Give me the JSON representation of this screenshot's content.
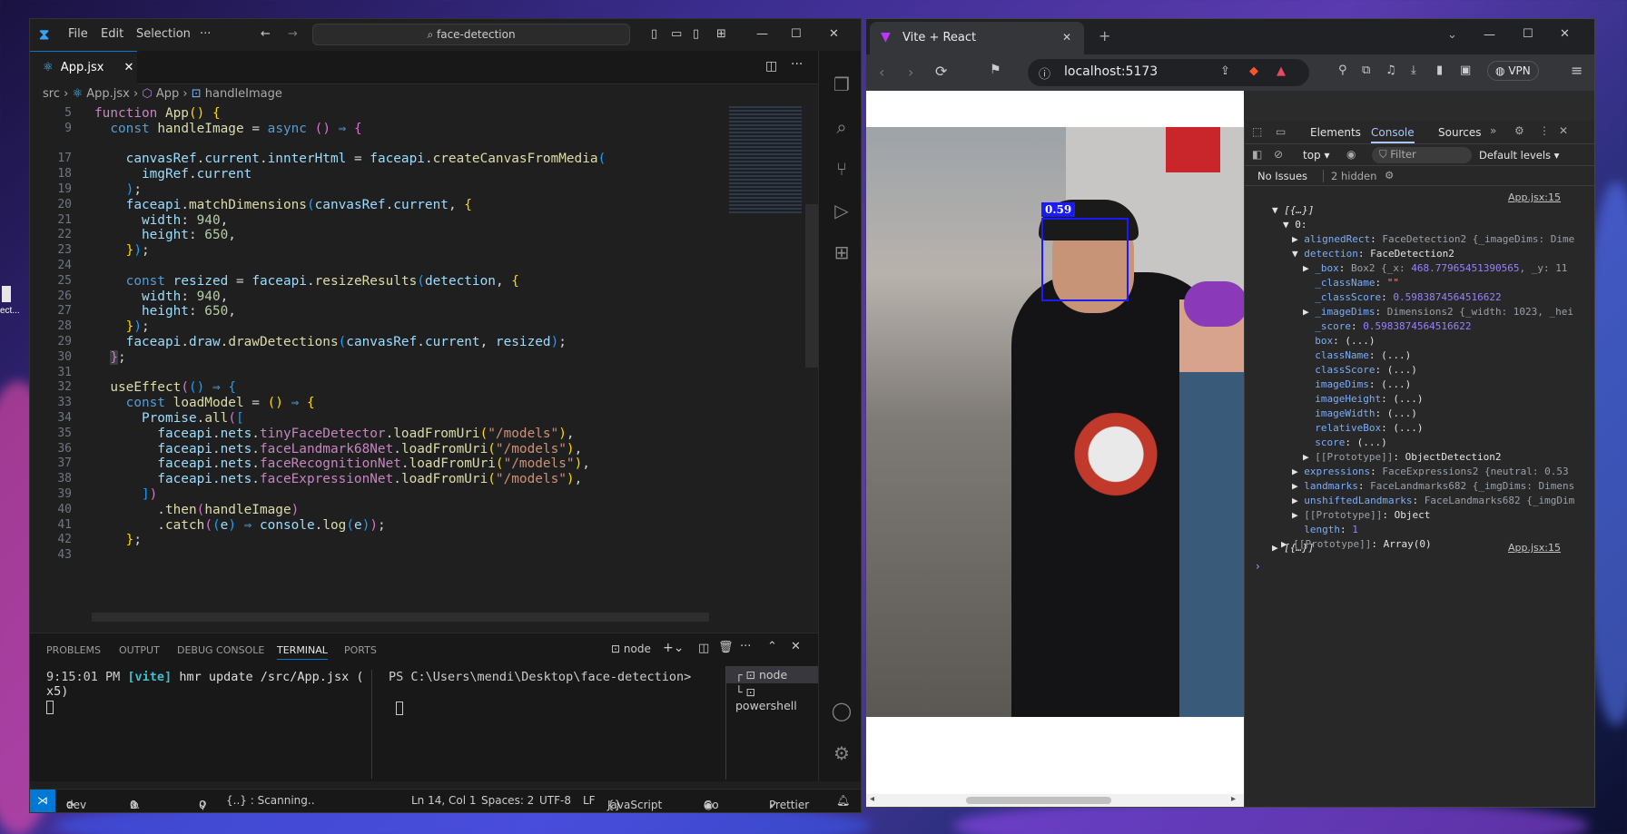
{
  "vscode": {
    "menu": [
      "File",
      "Edit",
      "Selection",
      "···"
    ],
    "search": "face-detection",
    "tab": "App.jsx",
    "breadcrumb": {
      "a": "src",
      "b": "App.jsx",
      "c": "App",
      "d": "handleImage"
    },
    "lines": [
      {
        "n": "5",
        "html": "<span class='kw'>function</span> <span class='fn'>App</span><span class='br1'>()</span> <span class='br1'>{</span>"
      },
      {
        "n": "9",
        "html": "  <span class='bl'>const</span> <span class='fn'>handleImage</span> <span class='pu'>=</span> <span class='bl'>async</span> <span class='br2'>()</span> <span class='bl'>⇒</span> <span class='br2'>{</span>"
      },
      {
        "n": "",
        "html": ""
      },
      {
        "n": "17",
        "html": "    <span class='vr'>canvasRef</span>.<span class='vr'>current</span>.<span class='vr'>innterHtml</span> = <span class='vr'>faceapi</span>.<span class='fn'>createCanvasFromMedia</span><span class='br3'>(</span>"
      },
      {
        "n": "18",
        "html": "      <span class='vr'>imgRef</span>.<span class='vr'>current</span>"
      },
      {
        "n": "19",
        "html": "    <span class='br3'>)</span>;"
      },
      {
        "n": "20",
        "html": "    <span class='vr'>faceapi</span>.<span class='fn'>matchDimensions</span><span class='br3'>(</span><span class='vr'>canvasRef</span>.<span class='vr'>current</span>, <span class='br1'>{</span>"
      },
      {
        "n": "21",
        "html": "      <span class='vr'>width</span>: <span class='nm'>940</span>,"
      },
      {
        "n": "22",
        "html": "      <span class='vr'>height</span>: <span class='nm'>650</span>,"
      },
      {
        "n": "23",
        "html": "    <span class='br1'>}</span><span class='br3'>)</span>;"
      },
      {
        "n": "24",
        "html": ""
      },
      {
        "n": "25",
        "html": "    <span class='bl'>const</span> <span class='vr'>resized</span> = <span class='vr'>faceapi</span>.<span class='fn'>resizeResults</span><span class='br3'>(</span><span class='vr'>detection</span>, <span class='br1'>{</span>"
      },
      {
        "n": "26",
        "html": "      <span class='vr'>width</span>: <span class='nm'>940</span>,"
      },
      {
        "n": "27",
        "html": "      <span class='vr'>height</span>: <span class='nm'>650</span>,"
      },
      {
        "n": "28",
        "html": "    <span class='br1'>}</span><span class='br3'>)</span>;"
      },
      {
        "n": "29",
        "html": "    <span class='vr'>faceapi</span>.<span class='vr'>draw</span>.<span class='fn'>drawDetections</span><span class='br3'>(</span><span class='vr'>canvasRef</span>.<span class='vr'>current</span>, <span class='vr'>resized</span><span class='br3'>)</span>;"
      },
      {
        "n": "30",
        "html": "  <span class='br2' style='background:#3a3d41'>}</span>;"
      },
      {
        "n": "31",
        "html": ""
      },
      {
        "n": "32",
        "html": "  <span class='fn'>useEffect</span><span class='br2'>(</span><span class='br3'>()</span> <span class='bl'>⇒</span> <span class='br3'>{</span>"
      },
      {
        "n": "33",
        "html": "    <span class='bl'>const</span> <span class='fn'>loadModel</span> = <span class='br1'>()</span> <span class='bl'>⇒</span> <span class='br1'>{</span>"
      },
      {
        "n": "34",
        "html": "      <span class='vr'>Promise</span>.<span class='fn'>all</span><span class='br2'>(</span><span class='br3'>[</span>"
      },
      {
        "n": "35",
        "html": "        <span class='vr'>faceapi</span>.<span class='vr'>nets</span>.<span class='kw'>tinyFaceDetector</span>.<span class='fn'>loadFromUri</span><span class='br1'>(</span><span class='st'>\"/models\"</span><span class='br1'>)</span>,"
      },
      {
        "n": "36",
        "html": "        <span class='vr'>faceapi</span>.<span class='vr'>nets</span>.<span class='kw'>faceLandmark68Net</span>.<span class='fn'>loadFromUri</span><span class='br1'>(</span><span class='st'>\"/models\"</span><span class='br1'>)</span>,"
      },
      {
        "n": "37",
        "html": "        <span class='vr'>faceapi</span>.<span class='vr'>nets</span>.<span class='kw'>faceRecognitionNet</span>.<span class='fn'>loadFromUri</span><span class='br1'>(</span><span class='st'>\"/models\"</span><span class='br1'>)</span>,"
      },
      {
        "n": "38",
        "html": "        <span class='vr'>faceapi</span>.<span class='vr'>nets</span>.<span class='kw'>faceExpressionNet</span>.<span class='fn'>loadFromUri</span><span class='br1'>(</span><span class='st'>\"/models\"</span><span class='br1'>)</span>,"
      },
      {
        "n": "39",
        "html": "      <span class='br3'>]</span><span class='br2'>)</span>"
      },
      {
        "n": "40",
        "html": "        .<span class='fn'>then</span><span class='br2'>(</span><span class='fn'>handleImage</span><span class='br2'>)</span>"
      },
      {
        "n": "41",
        "html": "        .<span class='fn'>catch</span><span class='br2'>(</span><span class='br3'>(</span><span class='vr'>e</span><span class='br3'>)</span> <span class='bl'>⇒</span> <span class='vr'>console</span>.<span class='fn'>log</span><span class='br3'>(</span><span class='vr'>e</span><span class='br3'>)</span><span class='br2'>)</span>;"
      },
      {
        "n": "42",
        "html": "    <span class='br1'>}</span>;"
      },
      {
        "n": "43",
        "html": ""
      }
    ],
    "panel_tabs": [
      "PROBLEMS",
      "OUTPUT",
      "DEBUG CONSOLE",
      "TERMINAL",
      "PORTS"
    ],
    "term_select": "node",
    "term1_l1a": "9:15:01 PM",
    "term1_l1b": "[vite]",
    "term1_l1c": "hmr update /src/App.jsx (",
    "term1_l2": "x5)",
    "term2_prompt": "PS C:\\Users\\mendi\\Desktop\\face-detection>",
    "term_list": [
      "node",
      "powershell"
    ],
    "status": {
      "branch": "dev",
      "errors": "0",
      "warnings": "0",
      "ports": "0",
      "scan": "{..} : Scanning..",
      "pos": "Ln 14, Col 1",
      "spaces": "Spaces: 2",
      "enc": "UTF-8",
      "eol": "LF",
      "lang": "JavaScript JSX",
      "live": "Go Live",
      "prettier": "Prettier"
    }
  },
  "browser": {
    "tab_title": "Vite + React",
    "url": "localhost:5173",
    "vpn": "VPN",
    "score_label": "0.59",
    "devtools": {
      "tabs": [
        "Elements",
        "Console",
        "Sources"
      ],
      "context": "top",
      "filter": "Filter",
      "levels": "Default levels",
      "issues": "No Issues",
      "hidden": "2 hidden",
      "src_link": "App.jsx:15",
      "src_link2": "App.jsx:15",
      "root": "▼ [{…}]",
      "row0": "▼ 0:",
      "root2": "▶ [{…}]"
    }
  },
  "desktop": {
    "icon_label": "ect..."
  }
}
